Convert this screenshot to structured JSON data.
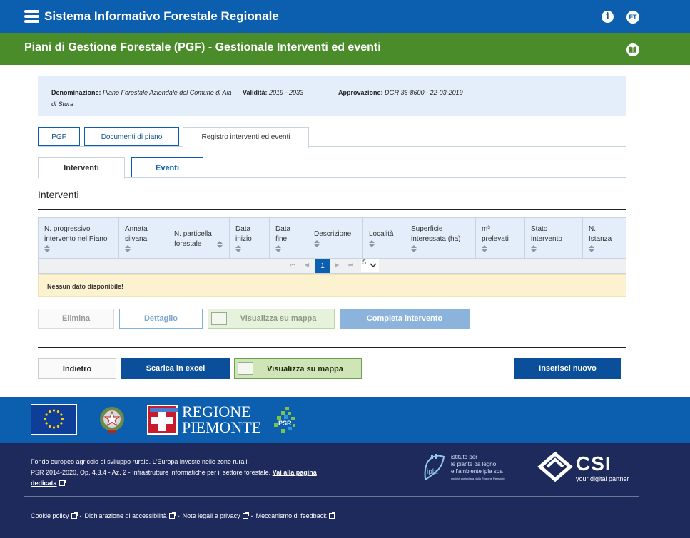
{
  "header": {
    "app_title": "Sistema Informativo Forestale Regionale",
    "info_icon": "i",
    "user_initials": "FT"
  },
  "subheader": {
    "page_title": "Piani di Gestione Forestale (PGF) - Gestionale Interventi ed eventi"
  },
  "info": {
    "denominazione_label": "Denominazione:",
    "denominazione_value": "Piano Forestale Aziendale del Comune di Aia di Stura",
    "validita_label": "Validità:",
    "validita_value": "2019 - 2033",
    "approvazione_label": "Approvazione:",
    "approvazione_value": "DGR 35-8600 - 22-03-2019"
  },
  "tabs": [
    {
      "label": "PGF"
    },
    {
      "label": "Documenti di piano"
    },
    {
      "label": "Registro interventi ed eventi"
    }
  ],
  "subtabs": [
    {
      "label": "Interventi"
    },
    {
      "label": "Eventi"
    }
  ],
  "section_title": "Interventi",
  "table": {
    "columns": [
      [
        "N. progressivo",
        "intervento nel Piano"
      ],
      [
        "Annata",
        "silvana"
      ],
      [
        "N. particella",
        "forestale"
      ],
      [
        "Data",
        "inizio"
      ],
      [
        "Data",
        "fine"
      ],
      [
        "Descrizione"
      ],
      [
        "Località"
      ],
      [
        "Superficie",
        "interessata (ha)"
      ],
      [
        "m³",
        "prelevati"
      ],
      [
        "Stato",
        "intervento"
      ],
      [
        "N.",
        "Istanza"
      ]
    ]
  },
  "pager": {
    "current_page": "1",
    "page_size": "5"
  },
  "empty_message": "Nessun dato disponibile!",
  "actions": {
    "elimina": "Elimina",
    "dettaglio": "Dettaglio",
    "visualizza_mappa": "Visualizza su mappa",
    "completa": "Completa intervento"
  },
  "bottom_actions": {
    "indietro": "Indietro",
    "excel": "Scarica in excel",
    "visualizza_mappa": "Visualizza su mappa",
    "nuovo": "Inserisci nuovo"
  },
  "logos": {
    "regione_line1": "REGIONE",
    "regione_line2": "PIEMONTE",
    "psr": "PSR"
  },
  "footer": {
    "line1": "Fondo europeo agricolo di sviluppo rurale. L'Europa investe nelle zone rurali.",
    "line2": "PSR 2014-2020, Op. 4.3.4 - Az. 2 - Infrastrutture informatiche per il settore forestale.",
    "link": "Vai alla pagina dedicata",
    "ipla_name_lines": [
      "istituto per",
      "le piante da legno",
      "e l'ambiente ipla spa"
    ],
    "ipla_sub": "società controllata dalla Regione Piemonte",
    "csi_word": "CSI",
    "csi_tag": "your digital partner",
    "links": [
      "Cookie policy",
      "Dichiarazione di accessibilità",
      "Note legali e privacy",
      "Meccanismo di feedback"
    ]
  },
  "colors": {
    "primary": "#0b5fae",
    "green": "#4a8c2a",
    "footer": "#1e2a5c"
  }
}
